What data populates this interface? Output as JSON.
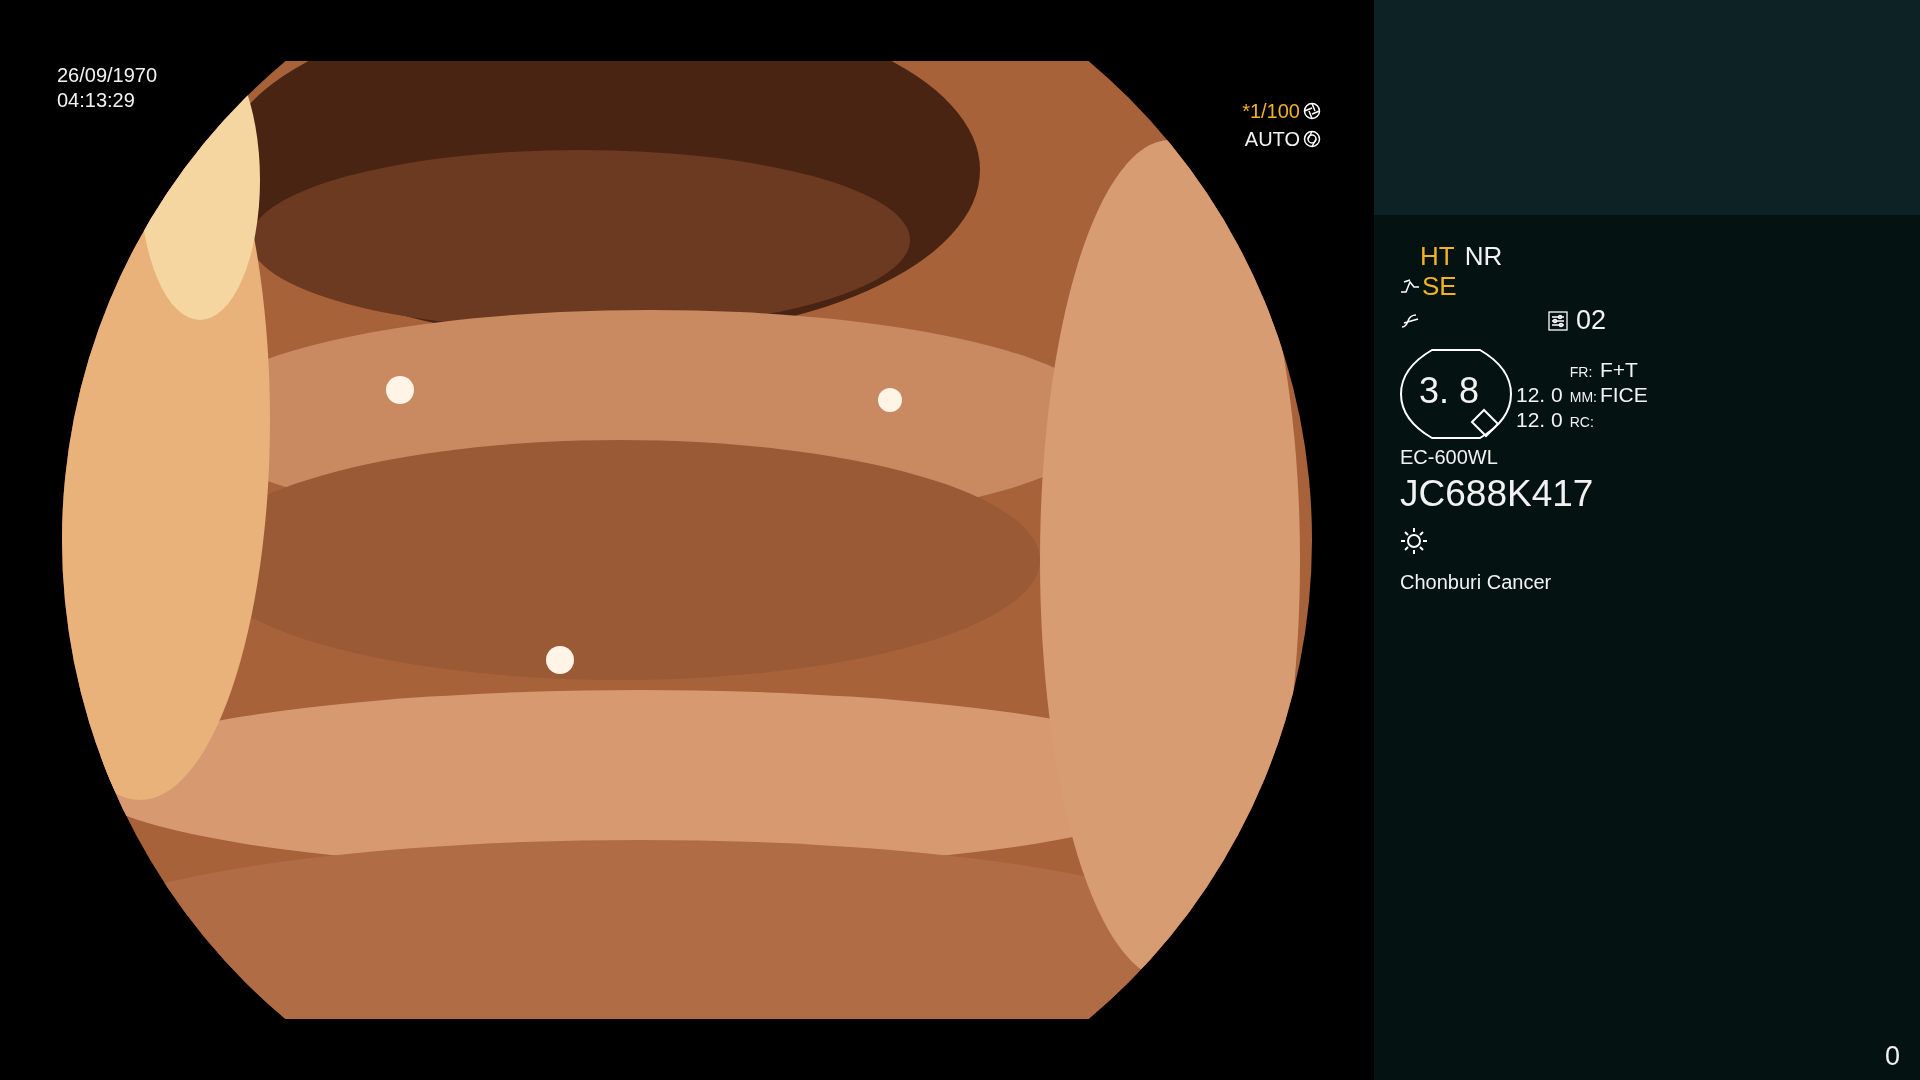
{
  "timestamp": {
    "date": "26/09/1970",
    "time": "04:13:29"
  },
  "exposure": {
    "shutter": "*1/100",
    "shutter_highlighted": true,
    "iris": "AUTO"
  },
  "panel": {
    "modes": [
      {
        "label": "HT",
        "active": true
      },
      {
        "label": "NR",
        "active": false
      }
    ],
    "enhancement": {
      "label": "SE",
      "active": true
    },
    "preset": "02",
    "zoom": "3. 8",
    "readings": [
      "12. 0",
      "12. 0"
    ],
    "fields": [
      {
        "key": "FR:",
        "value": "F+T"
      },
      {
        "key": "MM:",
        "value": "FICE"
      },
      {
        "key": "RC:"
      }
    ],
    "scope_model": "EC-600WL",
    "serial": "JC688K417",
    "institution": "Chonburi Cancer"
  },
  "counter": "0"
}
